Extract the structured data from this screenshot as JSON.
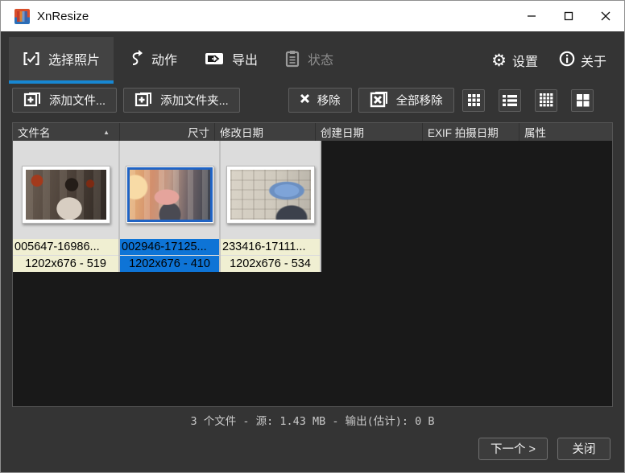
{
  "window": {
    "title": "XnResize",
    "controls": {
      "minimize": "—",
      "maximize": "",
      "close": ""
    }
  },
  "tabs": [
    {
      "label": "选择照片",
      "state": "active"
    },
    {
      "label": "动作",
      "state": "normal"
    },
    {
      "label": "导出",
      "state": "normal"
    },
    {
      "label": "状态",
      "state": "disabled"
    }
  ],
  "right_menu": {
    "settings": "设置",
    "about": "关于",
    "gear_glyph": "⚙"
  },
  "toolbar": {
    "add_files": "添加文件...",
    "add_folder": "添加文件夹...",
    "remove": "移除",
    "remove_all": "全部移除"
  },
  "table": {
    "columns": {
      "name": "文件名",
      "size": "尺寸",
      "modified": "修改日期",
      "created": "创建日期",
      "exif": "EXIF 拍摄日期",
      "attributes": "属性"
    },
    "sort_arrow": "▲"
  },
  "files": [
    {
      "name": "005647-16986...",
      "size": "1202x676 - 519",
      "selected": false
    },
    {
      "name": "002946-17125...",
      "size": "1202x676 - 410",
      "selected": true
    },
    {
      "name": "233416-17111...",
      "size": "1202x676 - 534",
      "selected": false
    }
  ],
  "status": "3 个文件 - 源: 1.43 MB - 输出(估计): 0 B",
  "footer": {
    "next": "下一个 >",
    "close": "关闭"
  },
  "colors": {
    "accent": "#1787d2",
    "selection": "#0e74d6",
    "titlebar": "#ffffff",
    "window_bg": "#343434",
    "list_bg": "#191919",
    "cell_bg": "#dcdcdc",
    "label_bg": "#f0efd2"
  }
}
